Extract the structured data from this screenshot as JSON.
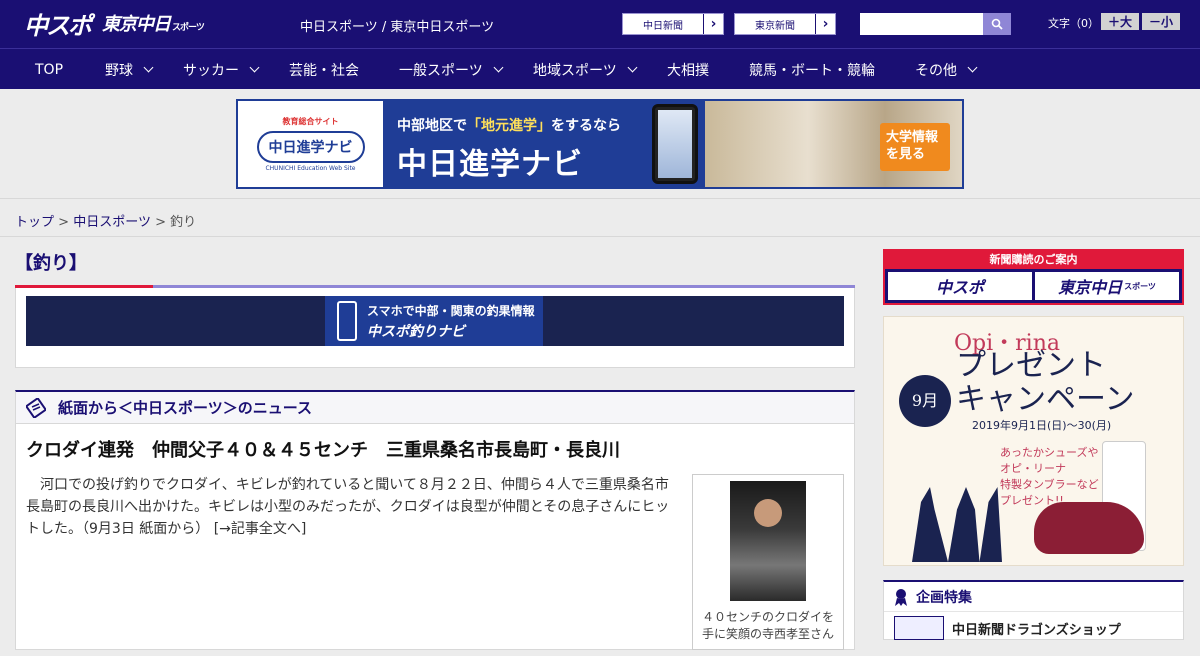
{
  "header": {
    "logo_chuspo": "中スポ",
    "logo_tokyo": "東京中日",
    "logo_tokyo_sub": "スポーツ",
    "site_title": "中日スポーツ / 東京中日スポーツ",
    "links": [
      {
        "label": "中日新聞"
      },
      {
        "label": "東京新聞"
      }
    ],
    "search_placeholder": "",
    "font_size_label": "文字（0）",
    "font_larger": "＋大",
    "font_smaller": "－小"
  },
  "nav": {
    "items": [
      {
        "label": "TOP"
      },
      {
        "label": "野球"
      },
      {
        "label": "サッカー"
      },
      {
        "label": "芸能・社会"
      },
      {
        "label": "一般スポーツ"
      },
      {
        "label": "地域スポーツ"
      },
      {
        "label": "大相撲"
      },
      {
        "label": "競馬・ボート・競輪"
      },
      {
        "label": "その他"
      }
    ]
  },
  "banner": {
    "small": "教育総合サイト",
    "logo": "中日進学ナビ",
    "logo_en": "CHUNICHI Education Web Site",
    "line1_pre": "中部地区で",
    "line1_hl": "「地元進学」",
    "line1_post": "をするなら",
    "line2": "中日進学ナビ",
    "cta": "大学情報を見る"
  },
  "breadcrumb": {
    "top": "トップ",
    "sep": ">",
    "section": "中日スポーツ",
    "current": "釣り"
  },
  "category": {
    "title": "【釣り】"
  },
  "tsuri_ad": {
    "line1": "スマホで中部・関東の釣果情報",
    "line2": "中スポ釣りナビ"
  },
  "news": {
    "heading": "紙面から＜中日スポーツ＞のニュース",
    "article": {
      "title": "クロダイ連発　仲間父子４０＆４５センチ　三重県桑名市長島町・長良川",
      "body": "河口での投げ釣りでクロダイ、キビレが釣れていると聞いて８月２２日、仲間ら４人で三重県桑名市長島町の長良川へ出かけた。キビレは小型のみだったが、クロダイは良型が仲間とその息子さんにヒットした。（9月3日 紙面から）",
      "more": "[→記事全文へ]",
      "caption": "４０センチのクロダイを手に笑顔の寺西孝至さん"
    }
  },
  "sidebar": {
    "subscribe_head": "新聞購読のご案内",
    "subscribe_a": "中スポ",
    "subscribe_b": "東京中日",
    "subscribe_b_sub": "スポーツ",
    "promo": {
      "brand": "Opi・rina",
      "month": "9月",
      "headline_1": "プレゼント",
      "headline_2": "キャンペーン",
      "dates": "2019年9月1日(日)〜30(月)",
      "msg_1": "あったかシューズや",
      "msg_2": "オピ・リーナ",
      "msg_3": "特製タンブラーなど",
      "msg_4": "プレゼント!!"
    },
    "feature_head": "企画特集",
    "feature_item": "中日新聞ドラゴンズショップ"
  },
  "colors": {
    "brand_navy": "#1a0f73",
    "accent_red": "#e0193a",
    "accent_lavender": "#8f86d6"
  }
}
